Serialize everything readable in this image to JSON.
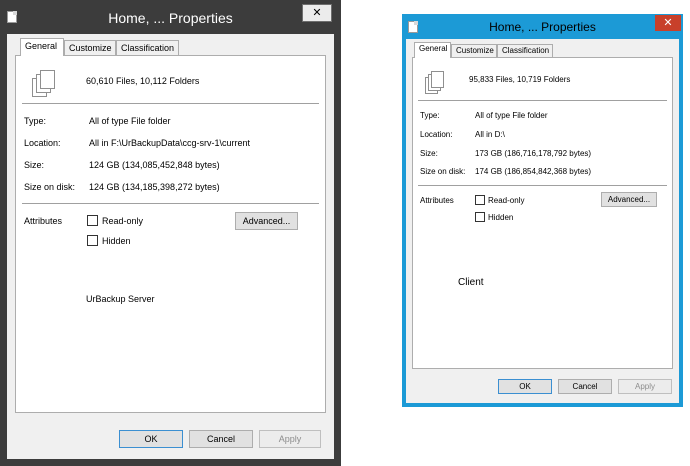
{
  "server_dialog": {
    "title": "Home, ... Properties",
    "close_glyph": "✕",
    "tabs": [
      "General",
      "Customize",
      "Classification"
    ],
    "summary": "60,610 Files, 10,112 Folders",
    "fields": [
      {
        "label": "Type:",
        "value": "All of type File folder"
      },
      {
        "label": "Location:",
        "value": "All in F:\\UrBackupData\\ccg-srv-1\\current"
      },
      {
        "label": "Size:",
        "value": "124 GB (134,085,452,848 bytes)"
      },
      {
        "label": "Size on disk:",
        "value": "124 GB (134,185,398,272 bytes)"
      }
    ],
    "attributes_label": "Attributes",
    "readonly_label": "Read-only",
    "hidden_label": "Hidden",
    "advanced_label": "Advanced...",
    "caption": "UrBackup Server",
    "ok_label": "OK",
    "cancel_label": "Cancel",
    "apply_label": "Apply"
  },
  "client_dialog": {
    "title": "Home, ... Properties",
    "close_glyph": "✕",
    "tabs": [
      "General",
      "Customize",
      "Classification"
    ],
    "summary": "95,833 Files, 10,719 Folders",
    "fields": [
      {
        "label": "Type:",
        "value": "All of type File folder"
      },
      {
        "label": "Location:",
        "value": "All in D:\\"
      },
      {
        "label": "Size:",
        "value": "173 GB (186,716,178,792 bytes)"
      },
      {
        "label": "Size on disk:",
        "value": "174 GB (186,854,842,368 bytes)"
      }
    ],
    "attributes_label": "Attributes",
    "readonly_label": "Read-only",
    "hidden_label": "Hidden",
    "advanced_label": "Advanced...",
    "caption": "Client",
    "ok_label": "OK",
    "cancel_label": "Cancel",
    "apply_label": "Apply"
  },
  "colors": {
    "server_frame": "#3c3c3c",
    "client_frame": "#1c9ad6",
    "client_close": "#c8402a"
  },
  "icons": [
    "document-icon",
    "folder-files-icon",
    "close-icon"
  ]
}
